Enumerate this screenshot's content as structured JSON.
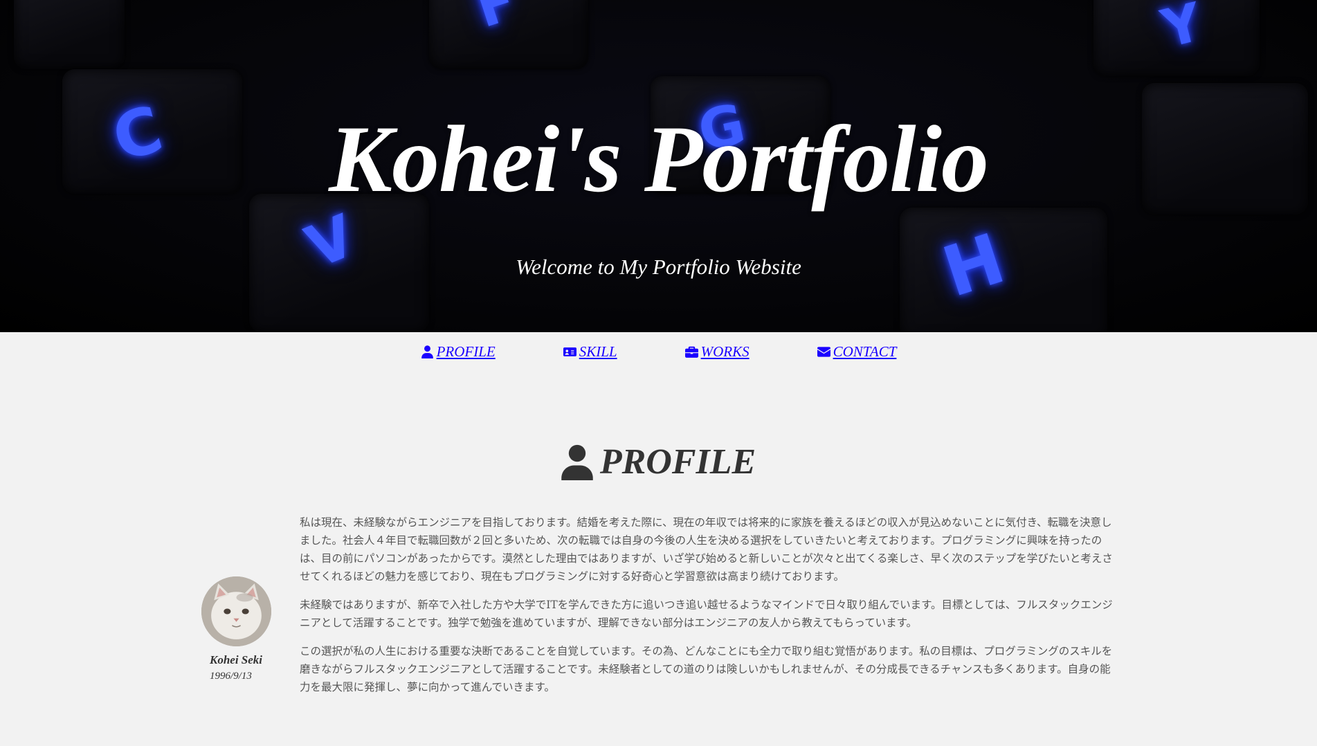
{
  "hero": {
    "title": "Kohei's Portfolio",
    "subtitle": "Welcome to My Portfolio Website",
    "background_keys": [
      "F",
      "Y",
      "C",
      "G",
      "V",
      "H"
    ]
  },
  "nav": {
    "items": [
      {
        "label": "PROFILE",
        "icon": "user-icon"
      },
      {
        "label": "SKILL",
        "icon": "id-card-icon"
      },
      {
        "label": "WORKS",
        "icon": "briefcase-icon"
      },
      {
        "label": "CONTACT",
        "icon": "envelope-icon"
      }
    ],
    "link_color": "#1a00ff"
  },
  "profile": {
    "heading": "PROFILE",
    "name": "Kohei Seki",
    "birthdate": "1996/9/13",
    "paragraphs": [
      "私は現在、未経験ながらエンジニアを目指しております。結婚を考えた際に、現在の年収では将来的に家族を養えるほどの収入が見込めないことに気付き、転職を決意しました。社会人４年目で転職回数が２回と多いため、次の転職では自身の今後の人生を決める選択をしていきたいと考えております。プログラミングに興味を持ったのは、目の前にパソコンがあったからです。漠然とした理由ではありますが、いざ学び始めると新しいことが次々と出てくる楽しさ、早く次のステップを学びたいと考えさせてくれるほどの魅力を感じており、現在もプログラミングに対する好奇心と学習意欲は高まり続けております。",
      "未経験ではありますが、新卒で入社した方や大学でITを学んできた方に追いつき追い越せるようなマインドで日々取り組んでいます。目標としては、フルスタックエンジニアとして活躍することです。独学で勉強を進めていますが、理解できない部分はエンジニアの友人から教えてもらっています。",
      "この選択が私の人生における重要な決断であることを自覚しています。その為、どんなことにも全力で取り組む覚悟があります。私の目標は、プログラミングのスキルを磨きながらフルスタックエンジニアとして活躍することです。未経験者としての道のりは険しいかもしれませんが、その分成長できるチャンスも多くあります。自身の能力を最大限に発揮し、夢に向かって進んでいきます。"
    ]
  }
}
